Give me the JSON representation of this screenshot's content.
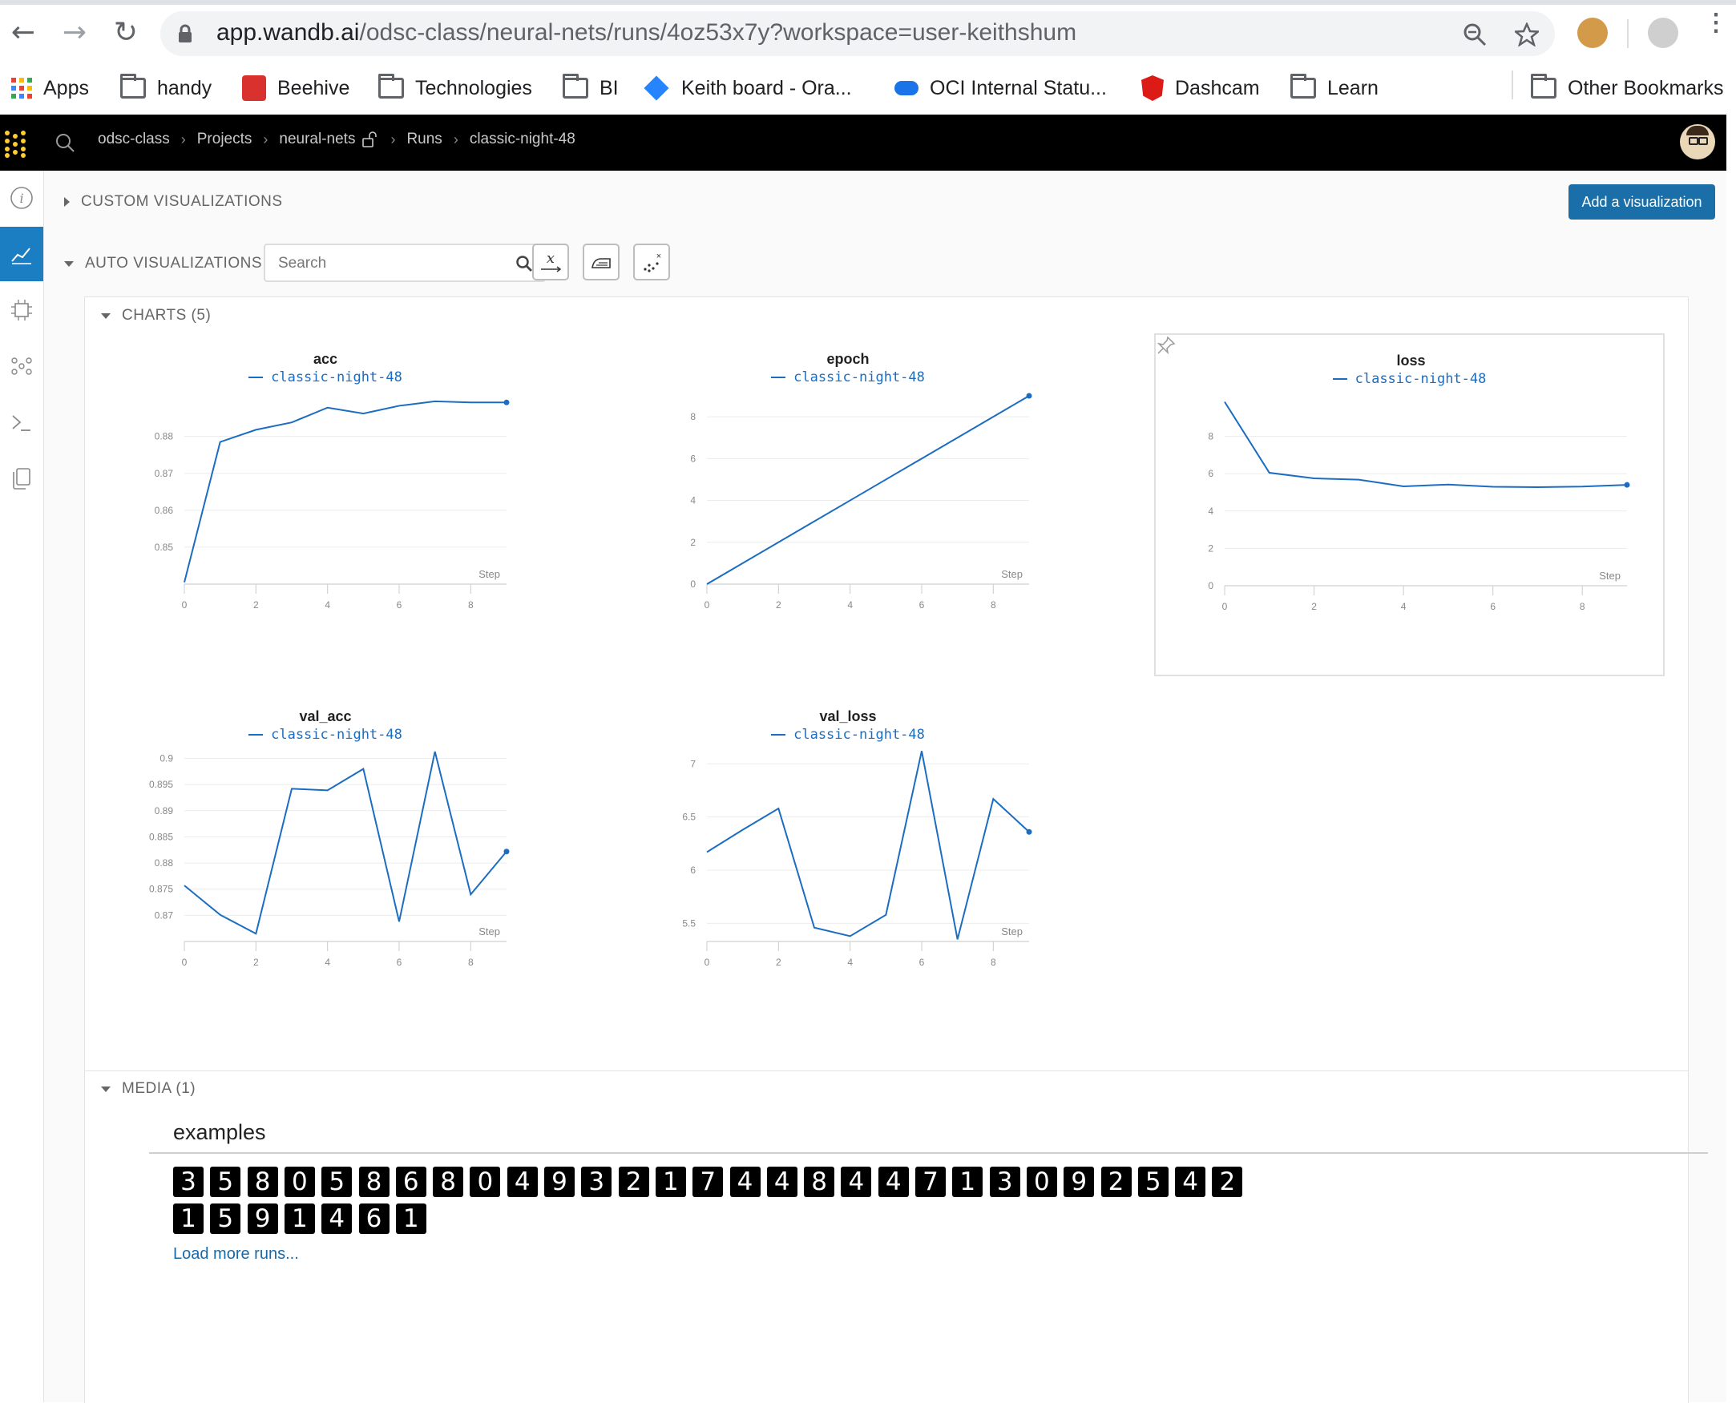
{
  "browser": {
    "url_host": "app.wandb.ai",
    "url_path": "/odsc-class/neural-nets/runs/4oz53x7y?workspace=user-keithshum",
    "bookmarks": [
      "Apps",
      "handy",
      "Beehive",
      "Technologies",
      "BI",
      "Keith board - Ora...",
      "OCI Internal Statu...",
      "Dashcam",
      "Learn"
    ],
    "other_bookmarks": "Other Bookmarks"
  },
  "header": {
    "breadcrumbs": [
      "odsc-class",
      "Projects",
      "neural-nets",
      "Runs",
      "classic-night-48"
    ]
  },
  "custom_viz": {
    "title": "CUSTOM VISUALIZATIONS",
    "add_button": "Add a visualization"
  },
  "auto_viz": {
    "title": "AUTO VISUALIZATIONS",
    "search_placeholder": "Search",
    "charts_header": "CHARTS (5)",
    "media_header": "MEDIA (1)"
  },
  "media": {
    "examples_title": "examples",
    "digits_row1": [
      "3",
      "5",
      "8",
      "0",
      "5",
      "8",
      "6",
      "8",
      "0",
      "4",
      "9",
      "3",
      "2",
      "1",
      "7",
      "4",
      "4",
      "8",
      "4",
      "4",
      "7",
      "1",
      "3",
      "0",
      "9",
      "2",
      "5",
      "4",
      "2"
    ],
    "digits_row2": [
      "1",
      "5",
      "9",
      "1",
      "4",
      "6",
      "1"
    ],
    "load_more": "Load more runs..."
  },
  "chart_data": [
    {
      "type": "line",
      "title": "acc",
      "xlabel": "Step",
      "series": [
        {
          "name": "classic-night-48",
          "values": [
            0.8405,
            0.8785,
            0.8818,
            0.8838,
            0.8878,
            0.8862,
            0.8883,
            0.8895,
            0.8892,
            0.8892
          ]
        }
      ],
      "x": [
        0,
        1,
        2,
        3,
        4,
        5,
        6,
        7,
        8,
        9
      ],
      "x_ticks": [
        0,
        2,
        4,
        6,
        8
      ],
      "y_ticks": [
        0.85,
        0.86,
        0.87,
        0.88
      ],
      "ylim": [
        0.84,
        0.891
      ],
      "color": "#1b6dc1"
    },
    {
      "type": "line",
      "title": "epoch",
      "xlabel": "Step",
      "series": [
        {
          "name": "classic-night-48",
          "values": [
            0,
            1,
            2,
            3,
            4,
            5,
            6,
            7,
            8,
            9
          ]
        }
      ],
      "x": [
        0,
        1,
        2,
        3,
        4,
        5,
        6,
        7,
        8,
        9
      ],
      "x_ticks": [
        0,
        2,
        4,
        6,
        8
      ],
      "y_ticks": [
        0,
        2,
        4,
        6,
        8
      ],
      "ylim": [
        0,
        9
      ],
      "color": "#1b6dc1"
    },
    {
      "type": "line",
      "title": "loss",
      "xlabel": "Step",
      "series": [
        {
          "name": "classic-night-48",
          "values": [
            9.85,
            6.05,
            5.75,
            5.68,
            5.32,
            5.42,
            5.3,
            5.28,
            5.31,
            5.4
          ]
        }
      ],
      "x": [
        0,
        1,
        2,
        3,
        4,
        5,
        6,
        7,
        8,
        9
      ],
      "x_ticks": [
        0,
        2,
        4,
        6,
        8
      ],
      "y_ticks": [
        0,
        2,
        4,
        6,
        8
      ],
      "ylim": [
        0,
        10
      ],
      "color": "#1b6dc1"
    },
    {
      "type": "line",
      "title": "val_acc",
      "xlabel": "Step",
      "series": [
        {
          "name": "classic-night-48",
          "values": [
            0.8757,
            0.8701,
            0.8665,
            0.8942,
            0.8939,
            0.898,
            0.8688,
            0.9013,
            0.874,
            0.8822
          ]
        }
      ],
      "x": [
        0,
        1,
        2,
        3,
        4,
        5,
        6,
        7,
        8,
        9
      ],
      "x_ticks": [
        0,
        2,
        4,
        6,
        8
      ],
      "y_ticks": [
        0.87,
        0.875,
        0.88,
        0.885,
        0.89,
        0.895,
        0.9
      ],
      "ylim": [
        0.865,
        0.901
      ],
      "color": "#1b6dc1"
    },
    {
      "type": "line",
      "title": "val_loss",
      "xlabel": "Step",
      "series": [
        {
          "name": "classic-night-48",
          "values": [
            6.17,
            6.38,
            6.58,
            5.46,
            5.38,
            5.58,
            7.12,
            5.35,
            6.67,
            6.36
          ]
        }
      ],
      "x": [
        0,
        1,
        2,
        3,
        4,
        5,
        6,
        7,
        8,
        9
      ],
      "x_ticks": [
        0,
        2,
        4,
        6,
        8
      ],
      "y_ticks": [
        5.5,
        6,
        6.5,
        7
      ],
      "ylim": [
        5.33,
        7.1
      ],
      "color": "#1b6dc1"
    }
  ]
}
